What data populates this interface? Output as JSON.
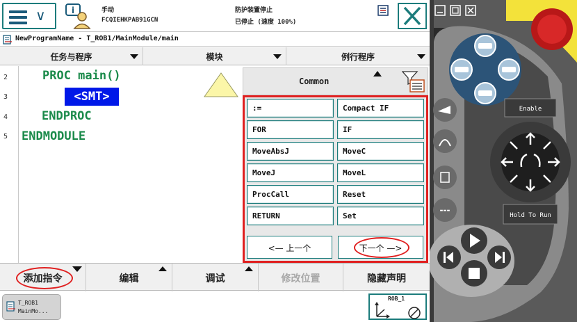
{
  "header": {
    "mode": "手动",
    "system": "FCQIEHKPAB91GCN",
    "safety": "防护装置停止",
    "state": "已停止 (速度 100%)"
  },
  "breadcrumb": "NewProgramName - T_ROB1/MainModule/main",
  "tabs": [
    {
      "label": "任务与程序"
    },
    {
      "label": "模块"
    },
    {
      "label": "例行程序"
    }
  ],
  "code": {
    "line_numbers": [
      "2",
      "3",
      "4",
      "5"
    ],
    "lines": [
      "PROC main()",
      "<SMT>",
      "ENDPROC",
      "ENDMODULE"
    ]
  },
  "picker": {
    "title": "Common",
    "items": [
      ":=",
      "Compact IF",
      "FOR",
      "IF",
      "MoveAbsJ",
      "MoveC",
      "MoveJ",
      "MoveL",
      "ProcCall",
      "Reset",
      "RETURN",
      "Set"
    ],
    "prev_label": "<—  上一个",
    "next_label": "下一个  —>"
  },
  "bottom_bar": {
    "add_instruction": "添加指令",
    "edit": "编辑",
    "debug": "调试",
    "modify_position": "修改位置",
    "hide_declarations": "隐藏声明"
  },
  "taskbar": {
    "task_line1": "T_ROB1",
    "task_line2": "MainMo...",
    "rob_label": "ROB_1"
  },
  "pendant": {
    "enable_label": "Enable",
    "hold_label": "Hold To Run"
  },
  "colors": {
    "accent": "#1c7c7c",
    "code_green": "#1a8a4a",
    "selection_blue": "#0018e8",
    "highlight_red": "#e02020"
  }
}
